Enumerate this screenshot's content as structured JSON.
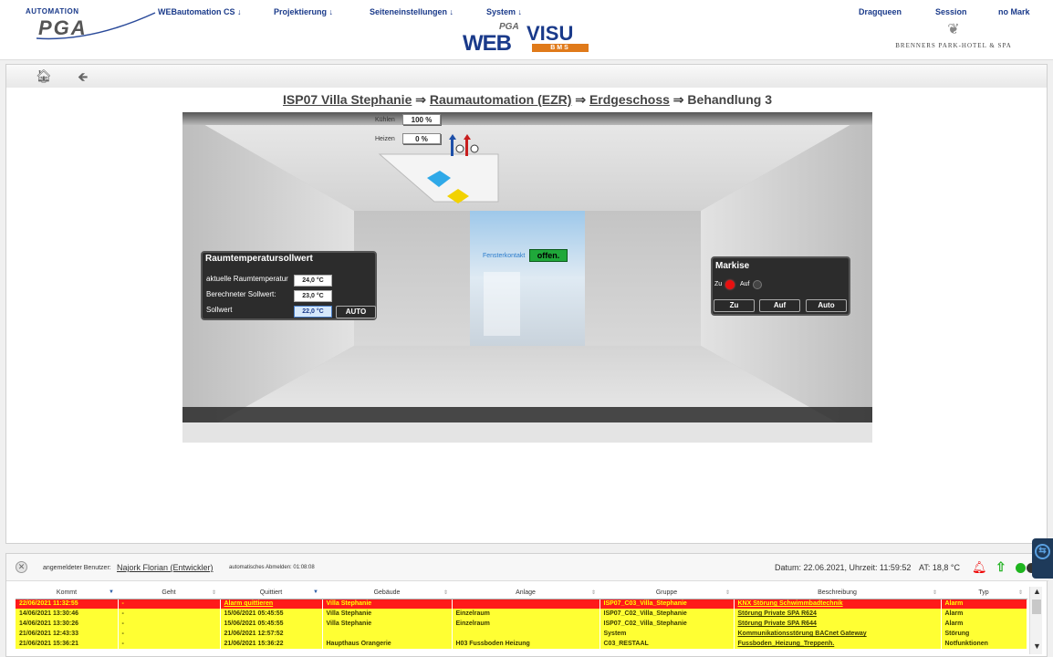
{
  "header": {
    "logo_top": "AUTOMATION",
    "logo_main": "PGA",
    "nav": [
      {
        "label": "WEBautomation CS ↓"
      },
      {
        "label": "Projektierung ↓"
      },
      {
        "label": "Seiteneinstellungen ↓"
      },
      {
        "label": "System ↓"
      }
    ],
    "right_nav": [
      {
        "label": "Dragqueen"
      },
      {
        "label": "Session"
      },
      {
        "label": "no Mark"
      }
    ],
    "webvisu": {
      "pga": "PGA",
      "web": "WEB",
      "visu": "VISU",
      "bms": "BMS"
    },
    "brenners": "BRENNERS PARK-HOTEL & SPA"
  },
  "breadcrumb": {
    "part1": "ISP07 Villa Stephanie",
    "sep": " ⇒ ",
    "part2": "Raumautomation (EZR)",
    "part3": "Erdgeschoss",
    "part4": "Behandlung 3"
  },
  "room": {
    "cooling_label": "Kühlen",
    "cooling_value": "100 %",
    "heating_label": "Heizen",
    "heating_value": "0 %",
    "temp_panel": {
      "title": "Raumtemperatursollwert",
      "row1_label": "aktuelle Raumtemperatur",
      "row1_value": "24,0 °C",
      "row2_label": "Berechneter Sollwert:",
      "row2_value": "23,0 °C",
      "row3_label": "Sollwert",
      "row3_value": "22,0 °C",
      "auto_label": "AUTO"
    },
    "window_label": "Fensterkontakt",
    "window_value": "offen.",
    "blind_panel": {
      "title": "Markise",
      "zu_label": "Zu",
      "auf_label": "Auf",
      "btn_zu": "Zu",
      "btn_auf": "Auf",
      "btn_auto": "Auto"
    },
    "colors": {
      "led_red": "#e81010",
      "led_off": "#444444",
      "window_ok": "#1fa83a"
    }
  },
  "status_bar": {
    "user_label": "angemeldeter Benutzer:",
    "user_name": "Najork Florian (Entwickler)",
    "logout": "automatisches Abmelden: 01:08:08",
    "date": "Datum: 22.06.2021, Uhrzeit: 11:59:52",
    "at": "AT: 18,8 °C"
  },
  "alarm_table": {
    "columns": [
      "Kommt",
      "Geht",
      "Quittiert",
      "Gebäude",
      "Anlage",
      "Gruppe",
      "Beschreibung",
      "Typ"
    ],
    "rows": [
      {
        "state": "active",
        "cells": [
          "22/06/2021 11:32:55",
          "-",
          "Alarm quittieren",
          "Villa Stephanie",
          "",
          "ISP07_C03_Villa_Stephanie",
          "KNX Störung Schwimmbadtechnik",
          "Alarm"
        ]
      },
      {
        "state": "ack",
        "cells": [
          "14/06/2021 13:30:46",
          "-",
          "15/06/2021 05:45:55",
          "Villa Stephanie",
          "Einzelraum",
          "ISP07_C02_Villa_Stephanie",
          "Störung Private SPA R624",
          "Alarm"
        ]
      },
      {
        "state": "ack",
        "cells": [
          "14/06/2021 13:30:26",
          "-",
          "15/06/2021 05:45:55",
          "Villa Stephanie",
          "Einzelraum",
          "ISP07_C02_Villa_Stephanie",
          "Störung Private SPA R644",
          "Alarm"
        ]
      },
      {
        "state": "ack",
        "cells": [
          "21/06/2021 12:43:33",
          "-",
          "21/06/2021 12:57:52",
          "",
          "",
          "System",
          "Kommunikationsstörung BACnet Gateway",
          "Störung"
        ]
      },
      {
        "state": "ack",
        "cells": [
          "21/06/2021 15:36:21",
          "-",
          "21/06/2021 15:36:22",
          "Haupthaus Orangerie",
          "H03 Fussboden Heizung",
          "C03_RESTAAL",
          "Fussboden_Heizung_Treppenh.",
          "Notfunktionen"
        ]
      }
    ]
  }
}
